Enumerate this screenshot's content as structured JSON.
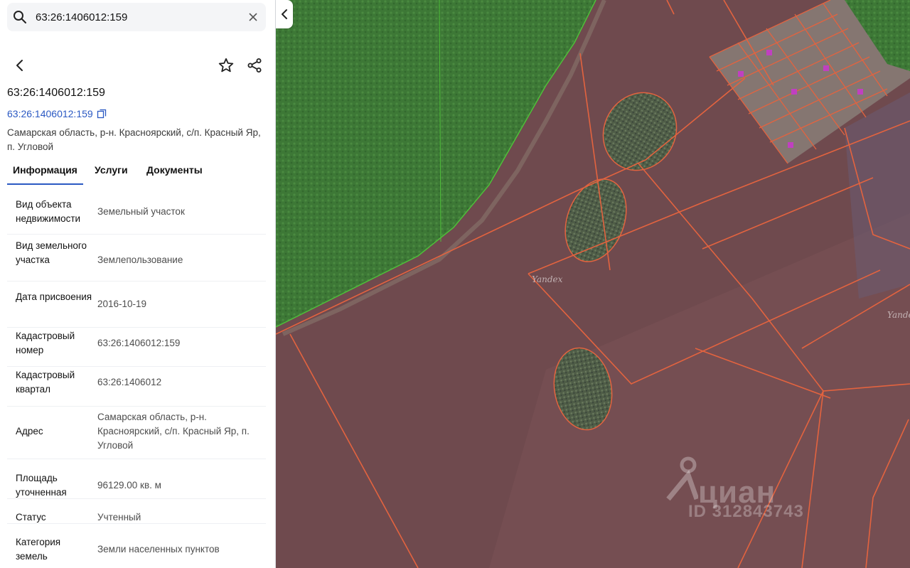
{
  "search": {
    "value": "63:26:1406012:159"
  },
  "object": {
    "title": "63:26:1406012:159",
    "link": "63:26:1406012:159",
    "address": "Самарская область, р-н. Красноярский, с/п. Красный Яр, п. Угловой"
  },
  "tabs": [
    {
      "label": "Информация",
      "active": true
    },
    {
      "label": "Услуги",
      "active": false
    },
    {
      "label": "Документы",
      "active": false
    }
  ],
  "properties": [
    {
      "key": "Вид объекта недвижимости",
      "value": "Земельный участок"
    },
    {
      "key": "Вид земельного участка",
      "value": "Землепользование"
    },
    {
      "key": "Дата присвоения",
      "value": "2016-10-19"
    },
    {
      "key": "Кадастровый номер",
      "value": "63:26:1406012:159"
    },
    {
      "key": "Кадастровый квартал",
      "value": "63:26:1406012"
    },
    {
      "key": "Адрес",
      "value": "Самарская область, р-н. Красноярский, с/п. Красный Яр, п. Угловой"
    },
    {
      "key": "Площадь уточненная",
      "value": "96129.00 кв. м"
    },
    {
      "key": "Статус",
      "value": "Учтенный"
    },
    {
      "key": "Категория земель",
      "value": "Земли населенных пунктов"
    }
  ],
  "map": {
    "provider_label_1": "Yandex",
    "provider_label_2": "Yandex",
    "watermark_brand": "циан",
    "watermark_id": "ID 312843743",
    "colors": {
      "parcel_border": "#e3633f",
      "parcel_fill": "#7a4f55",
      "forest": "#3f7a3a",
      "forest_border": "#4fbf3a",
      "accent": "#2b59c3"
    }
  },
  "icons": {
    "search": "search-icon",
    "clear": "close-icon",
    "back": "chevron-left-icon",
    "favorite": "star-icon",
    "share": "share-icon",
    "copy": "copy-icon",
    "collapse": "chevron-left-icon",
    "watermark_pin": "map-pin-icon"
  }
}
